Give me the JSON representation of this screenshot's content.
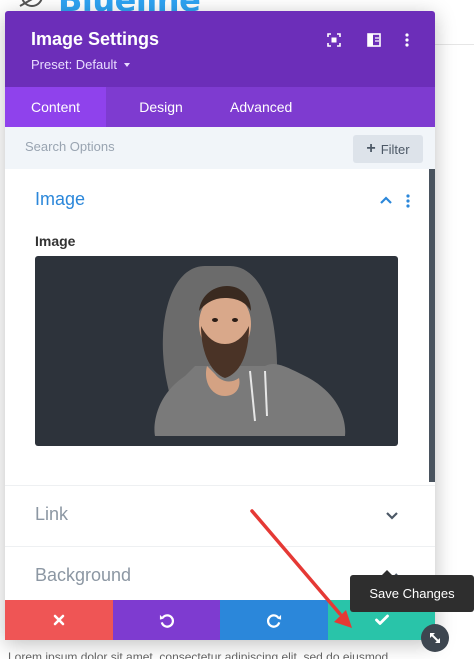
{
  "background": {
    "logo_text": "Blueline",
    "body_text": "Lorem ipsum dolor sit amet, consectetur adipiscing elit, sed do eiusmod"
  },
  "modal": {
    "title": "Image Settings",
    "preset_label": "Preset: Default",
    "tabs": [
      {
        "label": "Content",
        "active": true
      },
      {
        "label": "Design",
        "active": false
      },
      {
        "label": "Advanced",
        "active": false
      }
    ],
    "search": {
      "placeholder": "Search Options",
      "filter_label": "Filter"
    },
    "sections": {
      "image": {
        "title": "Image",
        "expanded": true,
        "field_label": "Image"
      },
      "link": {
        "title": "Link",
        "expanded": false
      },
      "background": {
        "title": "Background",
        "expanded": false
      }
    },
    "footer": {
      "save_tooltip": "Save Changes"
    }
  },
  "colors": {
    "header": "#6c2eb9",
    "tabs": "#7e3bd0",
    "active_tab": "#8f42ec",
    "accent_blue": "#2b87da",
    "cancel": "#ef5555",
    "undo": "#7e3bd0",
    "redo": "#2b87da",
    "save": "#29c4a9",
    "annotation_arrow": "#e53935"
  },
  "icons": {
    "header": [
      "focus-mode-icon",
      "split-view-icon",
      "more-vertical-icon"
    ],
    "footer": [
      "close-icon",
      "undo-icon",
      "redo-icon",
      "check-icon"
    ]
  }
}
